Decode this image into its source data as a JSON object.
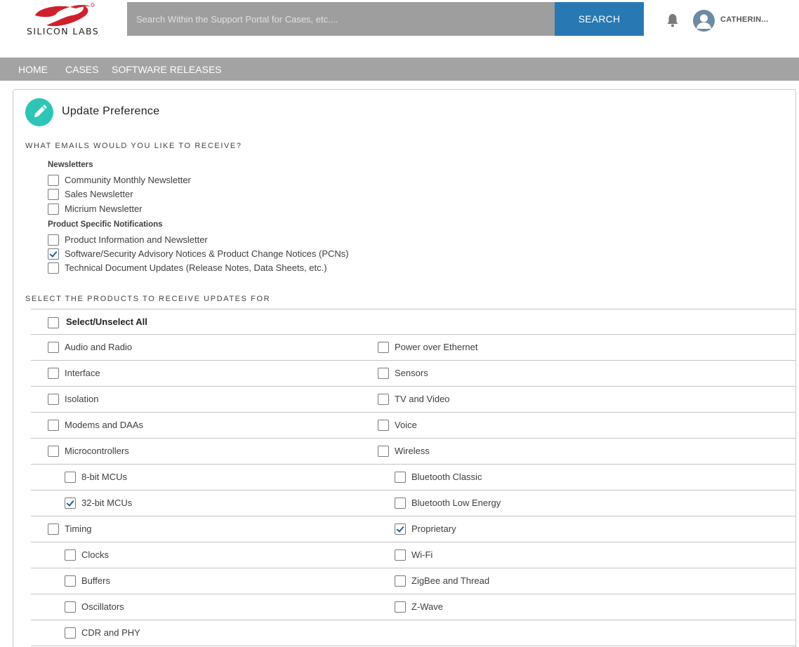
{
  "brand": {
    "name": "SILICON LABS",
    "color": "#d0202e"
  },
  "search": {
    "placeholder": "Search Within the Support Portal for Cases, etc....",
    "button_label": "SEARCH"
  },
  "user": {
    "name": "CATHERIN..."
  },
  "icons": {
    "bell": "bell-icon",
    "avatar": "user-avatar-icon",
    "edit": "pencil-icon"
  },
  "nav": {
    "items": [
      "HOME",
      "CASES",
      "SOFTWARE RELEASES"
    ]
  },
  "card": {
    "title": "Update Preference"
  },
  "emails": {
    "heading": "WHAT EMAILS WOULD YOU LIKE TO RECEIVE?",
    "groups": [
      {
        "label": "Newsletters",
        "items": [
          {
            "label": "Community Monthly Newsletter",
            "checked": false
          },
          {
            "label": "Sales Newsletter",
            "checked": false
          },
          {
            "label": "Micrium Newsletter",
            "checked": false
          }
        ]
      },
      {
        "label": "Product Specific Notifications",
        "items": [
          {
            "label": "Product Information and Newsletter",
            "checked": false
          },
          {
            "label": "Software/Security Advisory Notices & Product Change Notices (PCNs)",
            "checked": true
          },
          {
            "label": "Technical Document Updates (Release Notes, Data Sheets, etc.)",
            "checked": false
          }
        ]
      }
    ]
  },
  "products": {
    "heading": "SELECT THE PRODUCTS TO RECEIVE UPDATES FOR",
    "select_all": "Select/Unselect All",
    "rows": [
      {
        "left": {
          "label": "Audio and Radio",
          "checked": false,
          "sub": false
        },
        "right": {
          "label": "Power over Ethernet",
          "checked": false,
          "sub": false
        }
      },
      {
        "left": {
          "label": "Interface",
          "checked": false,
          "sub": false
        },
        "right": {
          "label": "Sensors",
          "checked": false,
          "sub": false
        }
      },
      {
        "left": {
          "label": "Isolation",
          "checked": false,
          "sub": false
        },
        "right": {
          "label": "TV and Video",
          "checked": false,
          "sub": false
        }
      },
      {
        "left": {
          "label": "Modems and DAAs",
          "checked": false,
          "sub": false
        },
        "right": {
          "label": "Voice",
          "checked": false,
          "sub": false
        }
      },
      {
        "left": {
          "label": "Microcontrollers",
          "checked": false,
          "sub": false
        },
        "right": {
          "label": "Wireless",
          "checked": false,
          "sub": false
        }
      },
      {
        "left": {
          "label": "8-bit MCUs",
          "checked": false,
          "sub": true
        },
        "right": {
          "label": "Bluetooth Classic",
          "checked": false,
          "sub": true
        }
      },
      {
        "left": {
          "label": "32-bit MCUs",
          "checked": true,
          "sub": true
        },
        "right": {
          "label": "Bluetooth Low Energy",
          "checked": false,
          "sub": true
        }
      },
      {
        "left": {
          "label": "Timing",
          "checked": false,
          "sub": false
        },
        "right": {
          "label": "Proprietary",
          "checked": true,
          "sub": true
        }
      },
      {
        "left": {
          "label": "Clocks",
          "checked": false,
          "sub": true
        },
        "right": {
          "label": "Wi-Fi",
          "checked": false,
          "sub": true
        }
      },
      {
        "left": {
          "label": "Buffers",
          "checked": false,
          "sub": true
        },
        "right": {
          "label": "ZigBee and Thread",
          "checked": false,
          "sub": true
        }
      },
      {
        "left": {
          "label": "Oscillators",
          "checked": false,
          "sub": true
        },
        "right": {
          "label": "Z-Wave",
          "checked": false,
          "sub": true
        }
      },
      {
        "left": {
          "label": "CDR and PHY",
          "checked": false,
          "sub": true
        },
        "right": null
      }
    ]
  }
}
